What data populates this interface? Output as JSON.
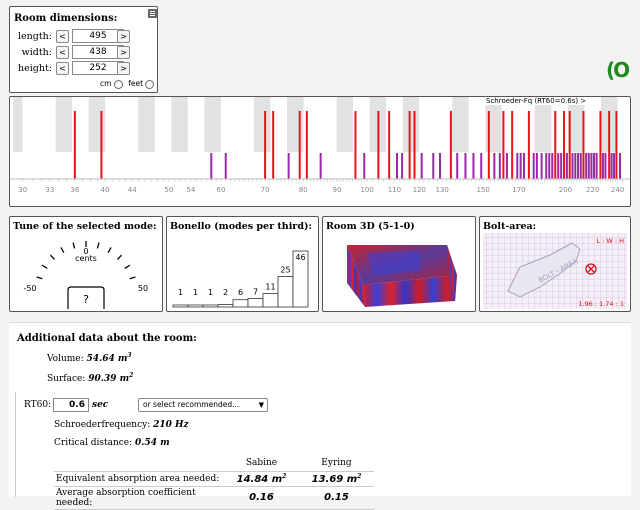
{
  "dimensions": {
    "title": "Room dimensions:",
    "fields": [
      {
        "label": "length:",
        "value": "495"
      },
      {
        "label": "width:",
        "value": "438"
      },
      {
        "label": "height:",
        "value": "252"
      }
    ],
    "dec_label": "<",
    "inc_label": ">",
    "unit_cm": "cm",
    "unit_feet": "feet"
  },
  "logo_text": "(O",
  "spectrum": {
    "schroeder_label": "Schroeder-Fq (RT60=0.6s) >",
    "tick_labels": [
      "30",
      "33",
      "36",
      "40",
      "44",
      "50",
      "54",
      "60",
      "70",
      "80",
      "90",
      "100",
      "110",
      "120",
      "130",
      "150",
      "170",
      "200",
      "220",
      "240"
    ],
    "modes_red_hz": [
      36,
      39.5,
      70,
      72,
      79,
      81,
      96,
      104,
      108,
      116,
      118,
      134,
      153,
      161,
      166,
      176,
      193,
      199,
      203,
      213,
      226,
      233,
      239
    ],
    "modes_purple_hz": [
      58,
      61,
      76,
      85,
      99,
      111,
      113,
      121,
      126,
      129,
      137,
      141,
      145,
      149,
      156,
      159,
      163,
      169,
      171,
      173,
      179,
      181,
      184,
      187,
      189,
      191,
      195,
      197,
      201,
      205,
      207,
      209,
      211,
      215,
      217,
      219,
      221,
      223,
      228,
      230,
      235,
      237,
      242
    ]
  },
  "tune": {
    "title": "Tune of the selected mode:",
    "center_value": "0",
    "unit": "cents",
    "left_value": "-50",
    "right_value": "50",
    "readout": "?"
  },
  "bonello": {
    "title": "Bonello (modes per third):",
    "bars": [
      {
        "label": "1",
        "value": 1
      },
      {
        "label": "1",
        "value": 1
      },
      {
        "label": "1",
        "value": 1
      },
      {
        "label": "2",
        "value": 2
      },
      {
        "label": "6",
        "value": 6
      },
      {
        "label": "7",
        "value": 7
      },
      {
        "label": "11",
        "value": 11
      },
      {
        "label": "25",
        "value": 25
      },
      {
        "label": "46",
        "value": 46
      }
    ]
  },
  "room3d": {
    "title": "Room 3D (5-1-0)"
  },
  "bolt": {
    "title": "Bolt-area:",
    "ratio_header": "L : W : H",
    "ratio_value": "1.96 : 1.74 : 1",
    "area_label": "BOLT - AREA"
  },
  "additional": {
    "title": "Additional data about the room:",
    "volume_label": "Volume:",
    "volume_value": "54.64 m",
    "volume_sup": "3",
    "surface_label": "Surface:",
    "surface_value": "90.39 m",
    "surface_sup": "2",
    "rt60_label": "RT60:",
    "rt60_value": "0.6",
    "rt60_unit": "sec",
    "recommend_placeholder": "or select recommended...",
    "schroeder_label": "Schroederfrequency:",
    "schroeder_value": "210 Hz",
    "critical_label": "Critical distance:",
    "critical_value": "0.54 m",
    "table": {
      "headers": [
        "",
        "Sabine",
        "Eyring"
      ],
      "rows": [
        {
          "label": "Equivalent absorption area needed:",
          "sabine": "14.84 m",
          "eyring": "13.69 m",
          "sup": "2"
        },
        {
          "label": "Average absorption coefficient needed:",
          "sabine": "0.16",
          "eyring": "0.15",
          "sup": ""
        }
      ]
    }
  },
  "colors": {
    "mode_red": "#e8141a",
    "mode_purple": "#9a2aa6",
    "logo_green": "#1e8a1e"
  }
}
